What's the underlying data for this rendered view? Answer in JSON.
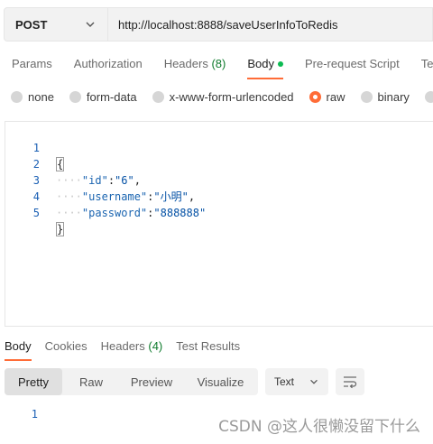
{
  "request": {
    "method": "POST",
    "url": "http://localhost:8888/saveUserInfoToRedis"
  },
  "request_tabs": [
    {
      "label": "Params"
    },
    {
      "label": "Authorization"
    },
    {
      "label": "Headers",
      "count": "(8)"
    },
    {
      "label": "Body",
      "active": true
    },
    {
      "label": "Pre-request Script"
    },
    {
      "label": "Te"
    }
  ],
  "body_types": [
    {
      "label": "none"
    },
    {
      "label": "form-data"
    },
    {
      "label": "x-www-form-urlencoded"
    },
    {
      "label": "raw",
      "selected": true
    },
    {
      "label": "binary"
    }
  ],
  "editor": {
    "line_numbers": [
      "1",
      "2",
      "3",
      "4",
      "5"
    ],
    "open_brace": "{",
    "close_brace": "}",
    "fields": [
      {
        "key": "\"id\"",
        "value": "\"6\"",
        "sep": ",",
        "indent": "····"
      },
      {
        "key": "\"username\"",
        "value": "\"小明\"",
        "sep": ",",
        "indent": "····"
      },
      {
        "key": "\"password\"",
        "value": "\"888888\"",
        "sep": "",
        "indent": "····"
      }
    ]
  },
  "response_tabs": [
    {
      "label": "Body",
      "active": true
    },
    {
      "label": "Cookies"
    },
    {
      "label": "Headers",
      "count": "(4)"
    },
    {
      "label": "Test Results"
    }
  ],
  "format_modes": [
    {
      "label": "Pretty",
      "active": true
    },
    {
      "label": "Raw"
    },
    {
      "label": "Preview"
    },
    {
      "label": "Visualize"
    }
  ],
  "text_select": "Text",
  "response_line_number": "1",
  "watermark": "CSDN @这人很懒没留下什么",
  "colors": {
    "accent": "#ff6c37",
    "dot": "#0cbb52",
    "count": "#0f7b2d"
  }
}
